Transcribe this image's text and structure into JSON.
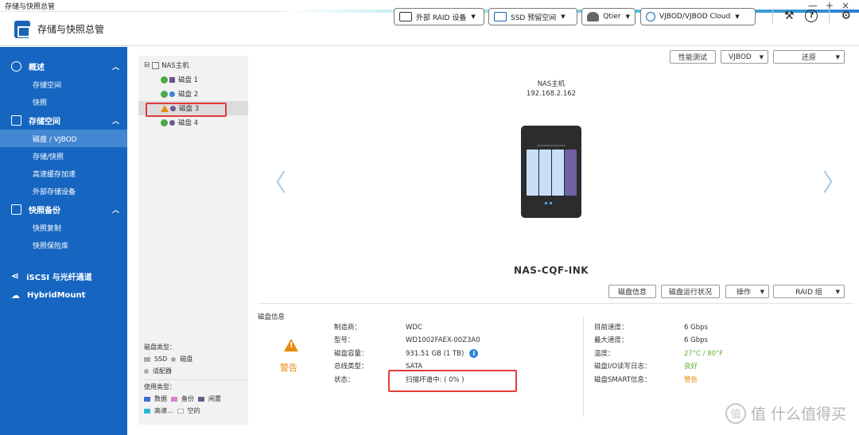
{
  "window": {
    "title": "存储与快照总管",
    "minimize": "—",
    "maximize": "+",
    "close": "×"
  },
  "header": {
    "app_title": "存储与快照总管",
    "toolbar": [
      {
        "label": "外部 RAID 设备",
        "icon": "external-raid-icon"
      },
      {
        "label": "SSD 预留空间",
        "icon": "ssd-icon"
      },
      {
        "label": "Qtier",
        "icon": "qtier-icon"
      },
      {
        "label": "VJBOD/VJBOD Cloud",
        "icon": "vjbod-cloud-icon"
      }
    ],
    "icons": [
      "tools-icon",
      "help-icon",
      "gear-icon"
    ]
  },
  "sidebar": {
    "sections": [
      {
        "label": "概述",
        "items": [
          "存储空间",
          "快照"
        ]
      },
      {
        "label": "存储空间",
        "items": [
          "磁盘 / VJBOD",
          "存储/快照",
          "高速缓存加速",
          "外部存储设备"
        ]
      },
      {
        "label": "快照备份",
        "items": [
          "快照复制",
          "快照保险库"
        ]
      }
    ],
    "extra": [
      "iSCSI 与光纤通道",
      "HybridMount"
    ],
    "active": "磁盘 / VJBOD"
  },
  "tree": {
    "root": "NAS主机",
    "disks": [
      {
        "label": "磁盘 1",
        "status": "ok",
        "marker": "square",
        "color": "#6d4e8e"
      },
      {
        "label": "磁盘 2",
        "status": "ok",
        "marker": "dot",
        "color": "#3c7fd6"
      },
      {
        "label": "磁盘 3",
        "status": "warn",
        "marker": "dot",
        "color": "#6d5a8a"
      },
      {
        "label": "磁盘 4",
        "status": "ok",
        "marker": "dot",
        "color": "#6d5a8a"
      }
    ]
  },
  "legend": {
    "disk_type_title": "磁盘类型：",
    "disk_types": [
      "SSD",
      "磁盘",
      "适配器"
    ],
    "usage_title": "使用类型：",
    "usage_types": [
      {
        "label": "数据",
        "color": "#3c6fd6"
      },
      {
        "label": "备份",
        "color": "#d77fd0"
      },
      {
        "label": "闲置",
        "color": "#6d5a8a"
      },
      {
        "label": "高速...",
        "color": "#2bb6d6"
      },
      {
        "label": "空的",
        "color": "#ffffff"
      }
    ]
  },
  "main": {
    "top_buttons": {
      "perf_test": "性能测试",
      "vjbod": "VJBOD",
      "restore": "还原"
    },
    "nas_name": "NAS主机",
    "nas_ip": "192.168.2.162",
    "nas_model": "NAS-CQF-INK",
    "disk_buttons": {
      "disk_info": "磁盘信息",
      "disk_health": "磁盘运行状况",
      "actions": "操作",
      "raid_group": "RAID 组"
    }
  },
  "disk_info": {
    "title": "磁盘信息",
    "status_label": "警告",
    "left": [
      {
        "k": "制造商：",
        "v": "WDC"
      },
      {
        "k": "型号：",
        "v": "WD1002FAEX-00Z3A0"
      },
      {
        "k": "磁盘容量：",
        "v": "931.51 GB (1 TB)"
      },
      {
        "k": "总线类型：",
        "v": "SATA"
      },
      {
        "k": "状态：",
        "v": "扫描坏道中: ( 0% )"
      }
    ],
    "right": [
      {
        "k": "目前速度：",
        "v": "6 Gbps"
      },
      {
        "k": "最大速度：",
        "v": "6 Gbps"
      },
      {
        "k": "温度：",
        "v": "27°C / 80°F"
      },
      {
        "k": "磁盘I/O读写日志：",
        "v": "良好"
      },
      {
        "k": "磁盘SMART信息：",
        "v": "警告"
      }
    ]
  },
  "watermark": "值 什么值得买"
}
